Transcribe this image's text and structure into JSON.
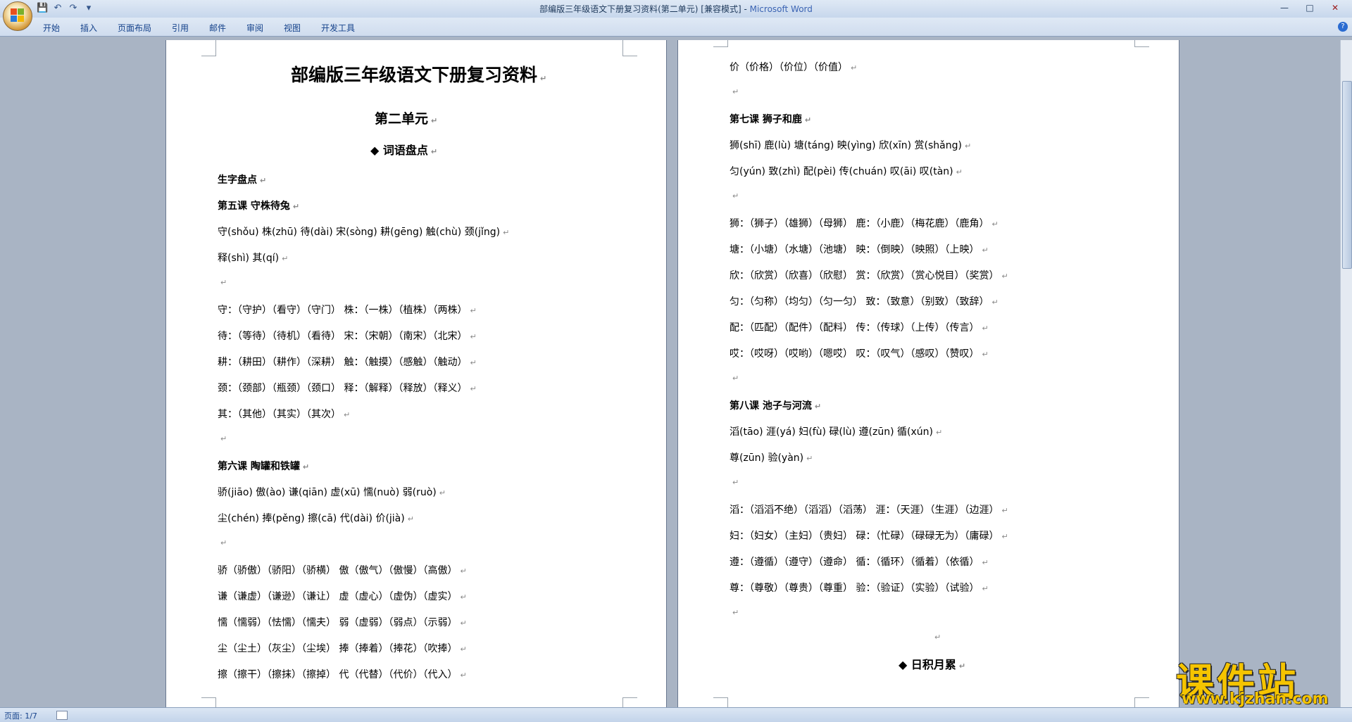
{
  "window": {
    "title_doc": "部编版三年级语文下册复习资料(第二单元) [兼容模式] - ",
    "title_app": "Microsoft Word",
    "help": "?"
  },
  "qat": {
    "save": "💾",
    "undo": "↶",
    "redo": "↷",
    "more": "▾"
  },
  "winctl": {
    "min": "—",
    "max": "□",
    "close": "✕"
  },
  "menu": [
    "开始",
    "插入",
    "页面布局",
    "引用",
    "邮件",
    "审阅",
    "视图",
    "开发工具"
  ],
  "mark": "↵",
  "page1": {
    "title": "部编版三年级语文下册复习资料",
    "unit": "第二单元",
    "section": "◆ 词语盘点",
    "lines": [
      {
        "t": "生字盘点",
        "b": true
      },
      {
        "t": "第五课  守株待兔",
        "b": true
      },
      {
        "t": "守(shǒu)   株(zhū)   待(dài)   宋(sòng)   耕(gēng)   触(chù)   颈(jǐng)"
      },
      {
        "t": "释(shì)    其(qí)"
      },
      {
        "t": ""
      },
      {
        "t": "守：（守护）（看守）（守门）        株：（一株）（植株）（两株）"
      },
      {
        "t": "待：（等待）（待机）（看待）        宋：（宋朝）（南宋）（北宋）"
      },
      {
        "t": "耕：（耕田）（耕作）（深耕）        触：（触摸）（感触）（触动）"
      },
      {
        "t": "颈：（颈部）（瓶颈）（颈口）        释：（解释）（释放）（释义）"
      },
      {
        "t": "其：（其他）（其实）（其次）"
      },
      {
        "t": ""
      },
      {
        "t": "第六课  陶罐和铁罐",
        "b": true
      },
      {
        "t": "骄(jiāo)   傲(ào)   谦(qiān)   虚(xū)   懦(nuò)   弱(ruò)"
      },
      {
        "t": "尘(chén)   捧(pěng)   擦(cā)  代(dài)   价(jià)"
      },
      {
        "t": ""
      },
      {
        "t": "骄（骄傲）（骄阳）（骄横）          傲（傲气）（傲慢）（高傲）"
      },
      {
        "t": "谦（谦虚）（谦逊）（谦让）          虚（虚心）（虚伪）（虚实）"
      },
      {
        "t": "懦（懦弱）（怯懦）（懦夫）          弱（虚弱）（弱点）（示弱）"
      },
      {
        "t": "尘（尘土）（灰尘）（尘埃）          捧（捧着）（捧花）（吹捧）"
      },
      {
        "t": "擦（擦干）（擦抹）（擦掉）          代（代替）（代价）（代入）"
      }
    ]
  },
  "page2": {
    "lines": [
      {
        "t": "价（价格）（价位）（价值）"
      },
      {
        "t": ""
      },
      {
        "t": "第七课 狮子和鹿",
        "b": true
      },
      {
        "t": "狮(shī)   鹿(lù)   塘(táng)   映(yìng)   欣(xīn)   赏(shǎng)"
      },
      {
        "t": "匀(yún)   致(zhì)   配(pèi)   传(chuán)   叹(āi)   叹(tàn)"
      },
      {
        "t": ""
      },
      {
        "t": "狮：（狮子）（雄狮）（母狮）          鹿：（小鹿）（梅花鹿）（鹿角）"
      },
      {
        "t": "塘：（小塘）（水塘）（池塘）          映：（倒映）（映照）（上映）"
      },
      {
        "t": "欣：（欣赏）（欣喜）（欣慰）          赏：（欣赏）（赏心悦目）（奖赏）"
      },
      {
        "t": "匀：（匀称）（均匀）（匀一匀）          致：（致意）（别致）（致辞）"
      },
      {
        "t": "配：（匹配）（配件）（配料）          传：（传球）（上传）（传言）"
      },
      {
        "t": "哎：（哎呀）（哎哟）（嗯哎）          叹：（叹气）（感叹）（赞叹）"
      },
      {
        "t": ""
      },
      {
        "t": "第八课 池子与河流",
        "b": true
      },
      {
        "t": "滔(tāo)   涯(yá)   妇(fù)   碌(lù)   遵(zūn)   循(xún)"
      },
      {
        "t": "尊(zūn)   验(yàn)"
      },
      {
        "t": ""
      },
      {
        "t": "滔：（滔滔不绝）（滔滔）（滔荡）          涯：（天涯）（生涯）（边涯）"
      },
      {
        "t": "妇：（妇女）（主妇）（贵妇）                碌：（忙碌）（碌碌无为）（庸碌）"
      },
      {
        "t": "遵：（遵循）（遵守）（遵命）                循：（循环）（循着）（依循）"
      },
      {
        "t": "尊：（尊敬）（尊贵）（尊重）                验：（验证）（实验）（试验）"
      },
      {
        "t": ""
      }
    ],
    "section": "◆ 日积月累"
  },
  "status": {
    "page": "页面: 1/7"
  },
  "watermark": {
    "big": "课件站",
    "url": "www.kjzhan.com"
  }
}
